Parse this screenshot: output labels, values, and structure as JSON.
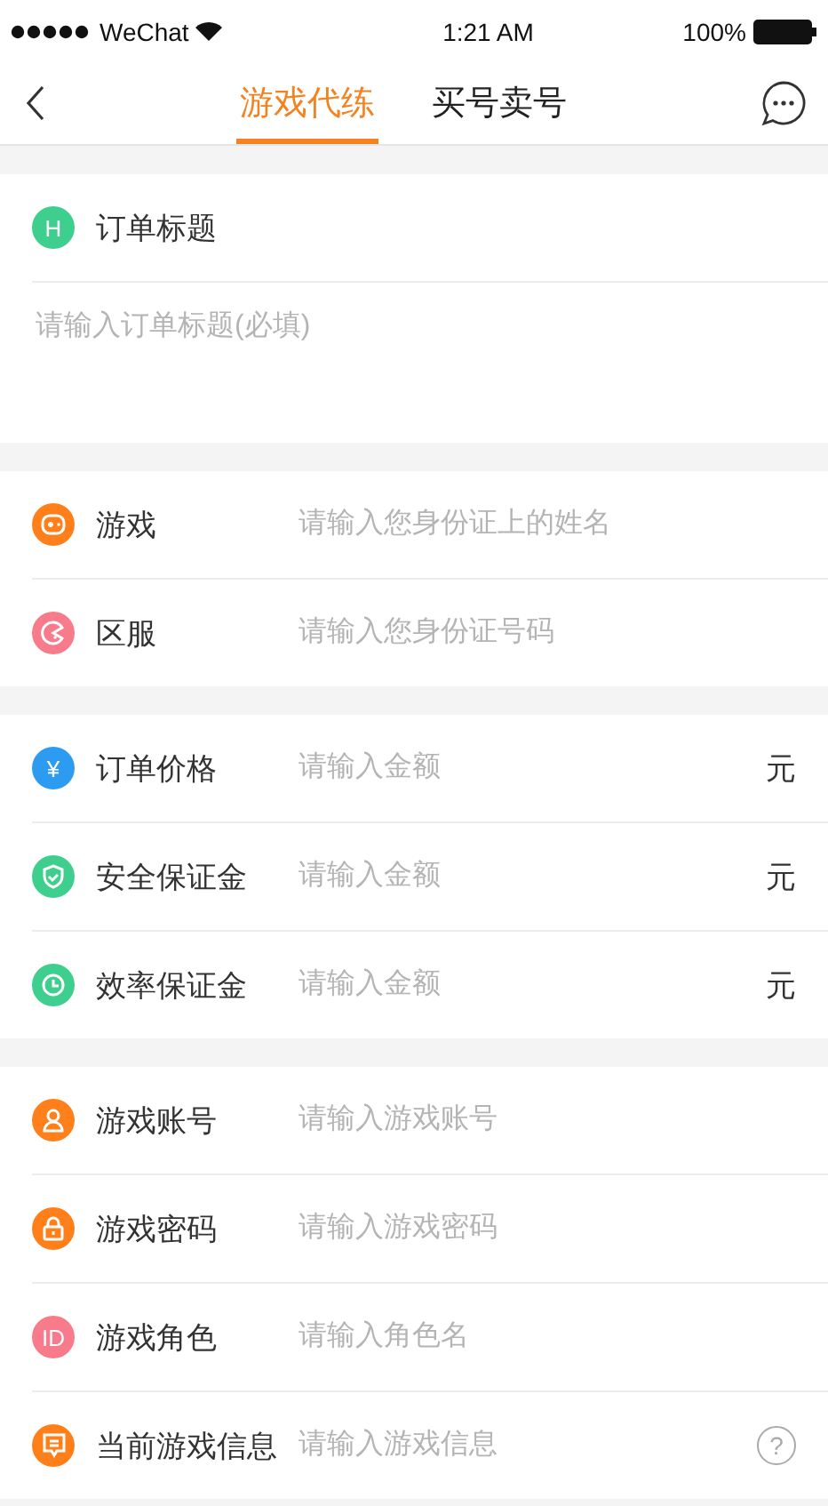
{
  "status_bar": {
    "carrier": "WeChat",
    "time": "1:21 AM",
    "battery": "100%"
  },
  "nav": {
    "tabs": [
      {
        "label": "游戏代练",
        "selected": true
      },
      {
        "label": "买号卖号",
        "selected": false
      }
    ]
  },
  "title_section": {
    "icon": {
      "kind": "letter",
      "glyph": "H",
      "color": "#3ecf8e"
    },
    "label": "订单标题",
    "placeholder": "请输入订单标题(必填)"
  },
  "groups": [
    {
      "rows": [
        {
          "icon": {
            "kind": "gamepad",
            "color": "#ff7f1a"
          },
          "label": "游戏",
          "placeholder": "请输入您身份证上的姓名"
        },
        {
          "icon": {
            "kind": "pacman",
            "color": "#f77b8a"
          },
          "label": "区服",
          "placeholder": "请输入您身份证号码"
        }
      ]
    },
    {
      "rows": [
        {
          "icon": {
            "kind": "letter",
            "glyph": "¥",
            "color": "#2d9bf0"
          },
          "label": "订单价格",
          "placeholder": "请输入金额",
          "suffix": "元"
        },
        {
          "icon": {
            "kind": "shield",
            "color": "#3ecf8e"
          },
          "label": "安全保证金",
          "placeholder": "请输入金额",
          "suffix": "元"
        },
        {
          "icon": {
            "kind": "clock",
            "color": "#3ecf8e"
          },
          "label": "效率保证金",
          "placeholder": "请输入金额",
          "suffix": "元"
        }
      ]
    },
    {
      "rows": [
        {
          "icon": {
            "kind": "person",
            "color": "#ff7f1a"
          },
          "label": "游戏账号",
          "placeholder": "请输入游戏账号"
        },
        {
          "icon": {
            "kind": "lock",
            "color": "#ff7f1a"
          },
          "label": "游戏密码",
          "placeholder": "请输入游戏密码"
        },
        {
          "icon": {
            "kind": "letter",
            "glyph": "ID",
            "color": "#f77b8a"
          },
          "label": "游戏角色",
          "placeholder": "请输入角色名"
        },
        {
          "icon": {
            "kind": "message",
            "color": "#ff7f1a"
          },
          "label": "当前游戏信息",
          "placeholder": "请输入游戏信息",
          "help": "?"
        }
      ]
    }
  ]
}
